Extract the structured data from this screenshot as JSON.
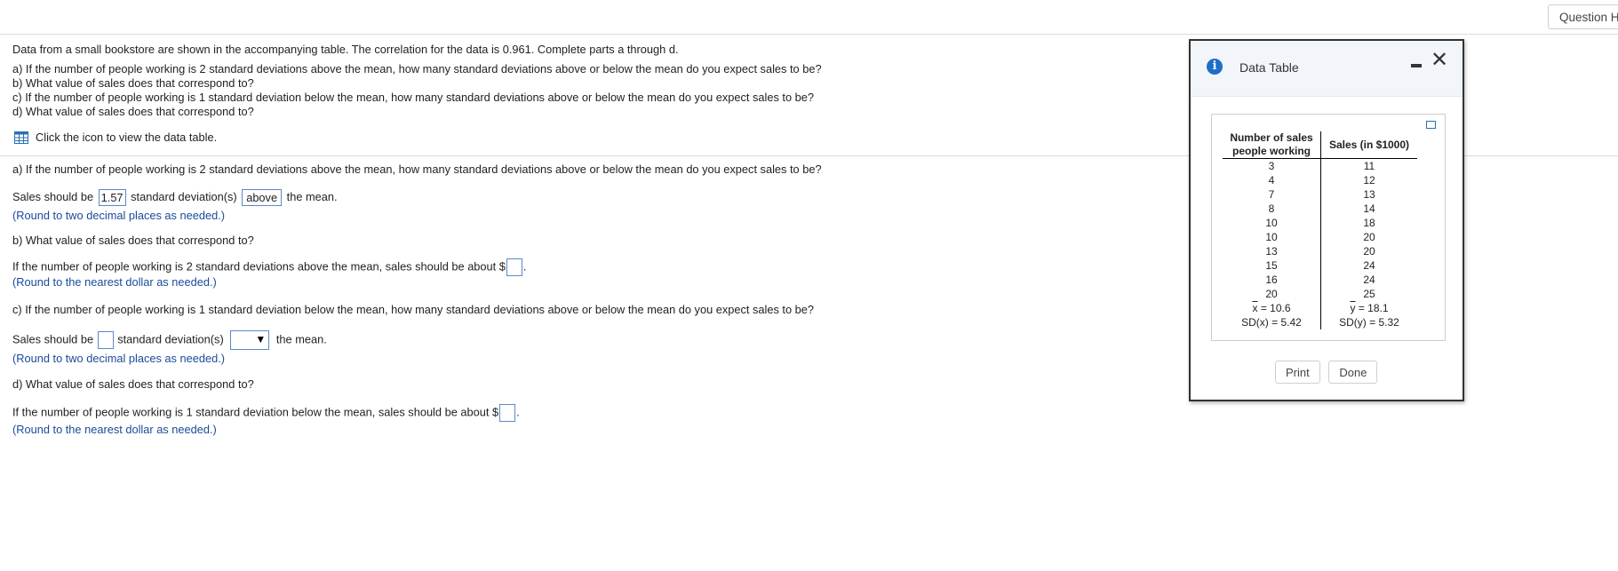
{
  "header": {
    "question_help_label": "Question Help"
  },
  "intro": {
    "line1": "Data from a small bookstore are shown in the accompanying table. The correlation for the data is 0.961. Complete parts a through d.",
    "qa": "a) If the number of people working is 2 standard deviations above the mean, how many standard deviations above or below the mean do you expect sales to be?",
    "qb": "b) What value of sales does that correspond to?",
    "qc": "c) If the number of people working is 1 standard deviation below the mean, how many standard deviations above or below the mean do you expect sales to be?",
    "qd": "d) What value of sales does that correspond to?"
  },
  "table_link": {
    "icon": "grid-table-icon",
    "label": "Click the icon to view the data table."
  },
  "part_a": {
    "question": "a) If the number of people working is 2 standard deviations above the mean, how many standard deviations above or below the mean do you expect sales to be?",
    "prefix": "Sales should be",
    "answer": "1.57",
    "middle": "standard deviation(s)",
    "direction": "above",
    "suffix": "the mean.",
    "hint": "(Round to two decimal places as needed.)"
  },
  "part_b": {
    "question": "b) What value of sales does that correspond to?",
    "prefix": "If the number of people working is 2 standard deviations above the mean, sales should be about $",
    "suffix": ".",
    "hint": "(Round to the nearest dollar as needed.)"
  },
  "part_c": {
    "question": "c) If the number of people working is 1 standard deviation below the mean, how many standard deviations above or below the mean do you expect sales to be?",
    "prefix": "Sales should be",
    "middle": "standard deviation(s)",
    "suffix": "the mean.",
    "hint": "(Round to two decimal places as needed.)"
  },
  "part_d": {
    "question": "d) What value of sales does that correspond to?",
    "prefix": "If the number of people working is 1 standard deviation below the mean, sales should be about $",
    "suffix": ".",
    "hint": "(Round to the nearest dollar as needed.)"
  },
  "modal": {
    "title": "Data Table",
    "col1_header_line1": "Number of sales",
    "col1_header_line2": "people working",
    "col2_header": "Sales (in $1000)",
    "rows": [
      [
        "3",
        "11"
      ],
      [
        "4",
        "12"
      ],
      [
        "7",
        "13"
      ],
      [
        "8",
        "14"
      ],
      [
        "10",
        "18"
      ],
      [
        "10",
        "20"
      ],
      [
        "13",
        "20"
      ],
      [
        "15",
        "24"
      ],
      [
        "16",
        "24"
      ],
      [
        "20",
        "25"
      ]
    ],
    "xbar_symbol": "x",
    "xbar_value": " = 10.6",
    "ybar_symbol": "y",
    "ybar_value": " = 18.1",
    "sdx": "SD(x) = 5.42",
    "sdy": "SD(y) = 5.32",
    "print_label": "Print",
    "done_label": "Done"
  }
}
